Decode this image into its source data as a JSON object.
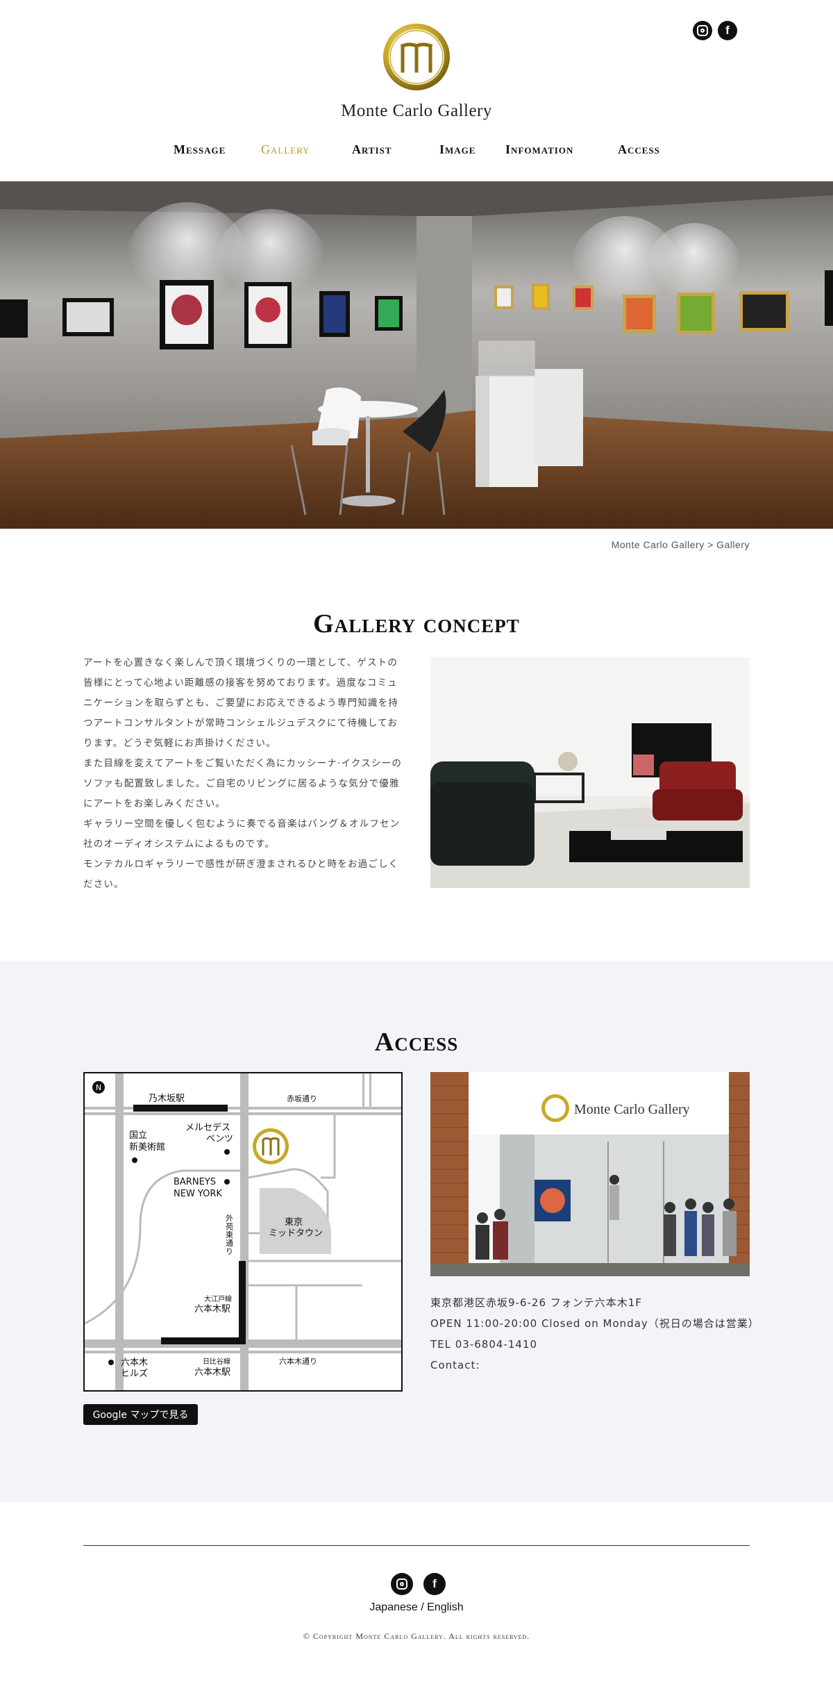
{
  "brand": {
    "name": "Monte Carlo Gallery",
    "accent": "#b39b2a"
  },
  "nav": [
    {
      "label": "Message",
      "active": false
    },
    {
      "label": "Gallery",
      "active": true
    },
    {
      "label": "Artist",
      "active": false
    },
    {
      "label": "Image",
      "active": false
    },
    {
      "label": "Infomation",
      "active": false
    },
    {
      "label": "Access",
      "active": false
    }
  ],
  "social": {
    "instagram": "instagram-icon",
    "facebook": "facebook-icon",
    "facebook_glyph": "f"
  },
  "breadcrumb": "Monte Carlo Gallery > Gallery",
  "concept": {
    "title": "Gallery concept",
    "paragraphs": [
      "アートを心置きなく楽しんで頂く環境づくりの一環として、ゲストの皆様にとって心地よい距離感の接客を努めております。過度なコミュニケーションを取らずとも、ご要望にお応えできるよう専門知識を持つアートコンサルタントが常時コンシェルジュデスクにて待機しております。どうぞ気軽にお声掛けください。",
      "また目線を変えてアートをご覧いただく為にカッシーナ·イクスシーのソファも配置致しました。ご自宅のリビングに居るような気分で優雅にアートをお楽しみください。",
      "ギャラリー空間を優しく包むように奏でる音楽はバング＆オルフセン社のオーディオシステムによるものです。",
      "モンテカルロギャラリーで感性が研ぎ澄まされるひと時をお過ごしください。"
    ]
  },
  "access": {
    "title": "Access",
    "map_labels": {
      "north": "N",
      "nogizaka": "乃木坂駅",
      "akasaka_dori": "赤坂通り",
      "national_art_center": "国立\n新美術館",
      "mercedes": "メルセデス\nベンツ",
      "barneys": "BARNEYS\nNEW YORK",
      "gaien": "外\n苑\n東\n通\nり",
      "midtown": "東京\nミッドタウン",
      "oedo_line": "大江戸線",
      "roppongi_oedo": "六本木駅",
      "roppongi_hills": "六本木\nヒルズ",
      "hibiya_line": "日比谷線",
      "roppongi_hibiya": "六本木駅",
      "roppongi_dori": "六本木通り"
    },
    "map_button": "Google マップで見る",
    "address": "東京都港区赤坂9-6-26 フォンテ六本木1F",
    "hours": "OPEN 11:00-20:00  Closed on Monday（祝日の場合は営業）",
    "tel": "TEL 03-6804-1410",
    "contact": "Contact:"
  },
  "footer": {
    "lang": "Japanese / English",
    "copyright": "© Copyright Monte Carlo Gallery. All rights reserved."
  }
}
